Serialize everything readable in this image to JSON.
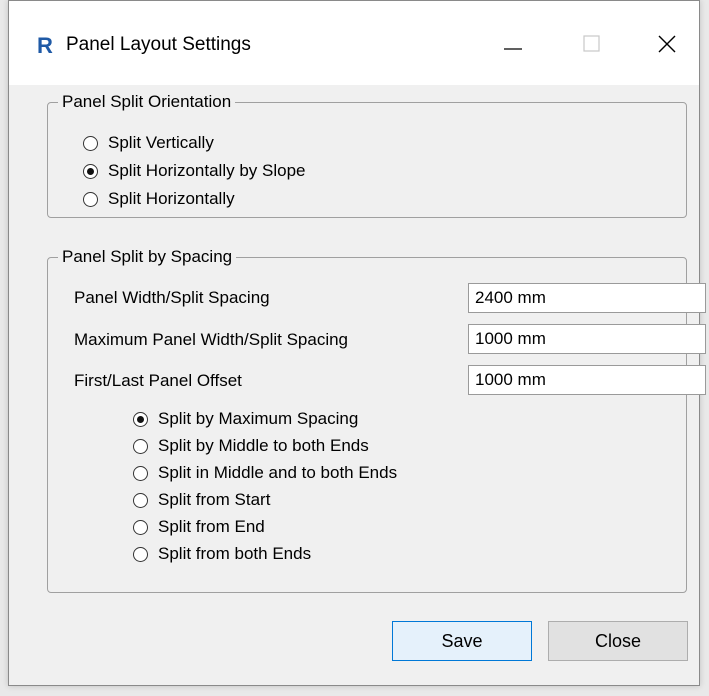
{
  "window": {
    "title": "Panel Layout Settings",
    "app_icon_letter": "R",
    "accent_color": "#1f5aa6"
  },
  "orientation_group": {
    "legend": "Panel Split Orientation",
    "options": [
      {
        "label": "Split Vertically",
        "checked": false
      },
      {
        "label": "Split Horizontally by Slope",
        "checked": true
      },
      {
        "label": "Split Horizontally",
        "checked": false
      }
    ]
  },
  "spacing_group": {
    "legend": "Panel Split by Spacing",
    "fields": [
      {
        "label": "Panel Width/Split Spacing",
        "value": "2400 mm"
      },
      {
        "label": "Maximum Panel Width/Split Spacing",
        "value": "1000 mm"
      },
      {
        "label": "First/Last Panel Offset",
        "value": "1000 mm"
      }
    ],
    "options": [
      {
        "label": "Split by Maximum Spacing",
        "checked": true
      },
      {
        "label": "Split by Middle to both Ends",
        "checked": false
      },
      {
        "label": "Split in Middle and to both Ends",
        "checked": false
      },
      {
        "label": "Split from Start",
        "checked": false
      },
      {
        "label": "Split from End",
        "checked": false
      },
      {
        "label": "Split from both Ends",
        "checked": false
      }
    ]
  },
  "buttons": {
    "save_label": "Save",
    "close_label": "Close"
  }
}
